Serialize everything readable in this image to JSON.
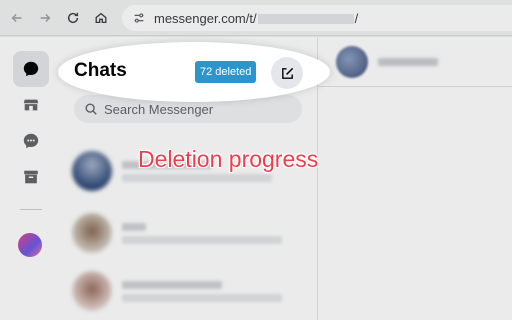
{
  "browser": {
    "url_prefix": "messenger.com/t/",
    "url_suffix": "/",
    "icons": [
      "back-arrow-icon",
      "forward-arrow-icon",
      "reload-icon",
      "home-icon",
      "site-info-icon"
    ]
  },
  "rail": {
    "items": [
      {
        "name": "chats",
        "icon": "chat-bubble-icon",
        "active": true
      },
      {
        "name": "marketplace",
        "icon": "store-icon",
        "active": false
      },
      {
        "name": "message-requests",
        "icon": "chat-dots-icon",
        "active": false
      },
      {
        "name": "archive",
        "icon": "archive-box-icon",
        "active": false
      }
    ]
  },
  "chat_list": {
    "title": "Chats",
    "deleted_badge": "72 deleted",
    "compose_icon": "compose-icon",
    "search_placeholder": "Search Messenger"
  },
  "annotation": "Deletion progress",
  "colors": {
    "badge": "#2c95cc",
    "annotation": "#ee3e4e"
  }
}
